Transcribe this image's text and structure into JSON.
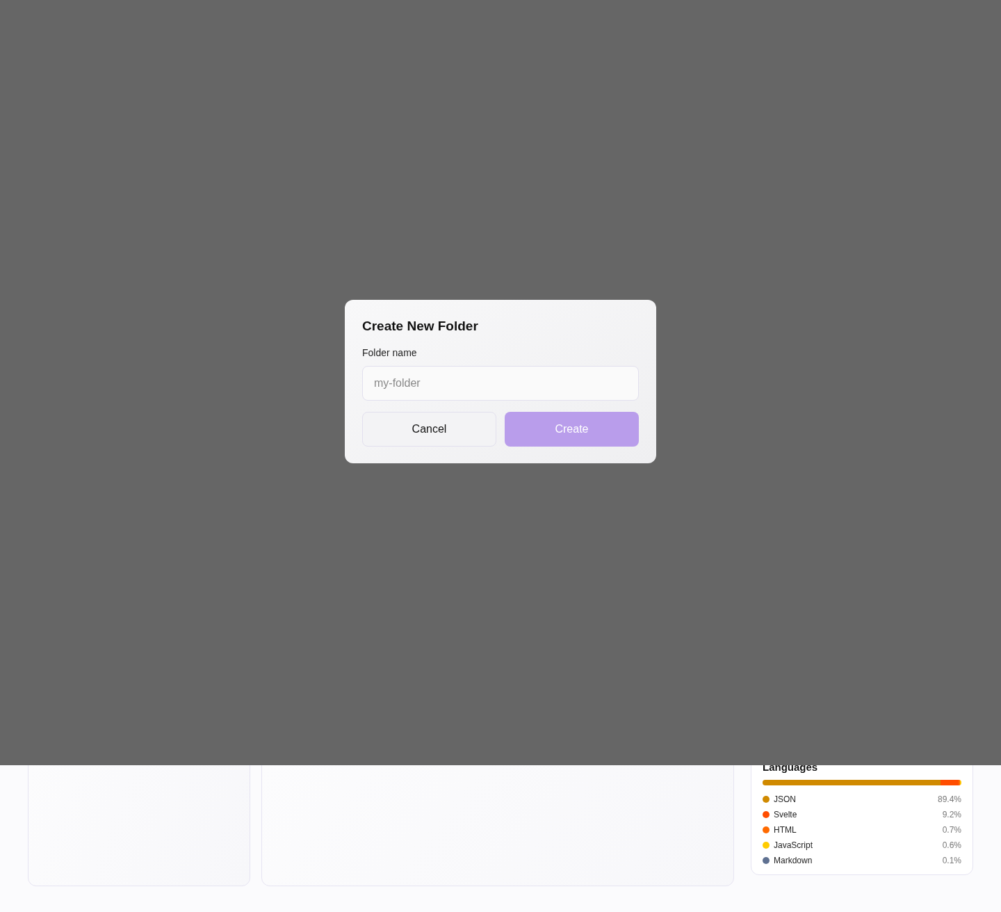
{
  "languages": {
    "title": "Languages",
    "items": [
      {
        "name": "JSON",
        "percent": "89.4%",
        "level": 0.894,
        "color": "#d08a00"
      },
      {
        "name": "Svelte",
        "percent": "9.2%",
        "level": 0.092,
        "color": "#ff4d00"
      },
      {
        "name": "HTML",
        "percent": "0.7%",
        "level": 0.007,
        "color": "#ff6a00"
      },
      {
        "name": "JavaScript",
        "percent": "0.6%",
        "level": 0.006,
        "color": "#ffcc00"
      },
      {
        "name": "Markdown",
        "percent": "0.1%",
        "level": 0.001,
        "color": "#5f7191"
      }
    ]
  },
  "dialog": {
    "title": "Create New Folder",
    "field_label": "Folder name",
    "placeholder": "my-folder",
    "buttons": [
      {
        "label": "Cancel",
        "kind": "secondary"
      },
      {
        "label": "Create",
        "kind": "primary"
      }
    ]
  }
}
